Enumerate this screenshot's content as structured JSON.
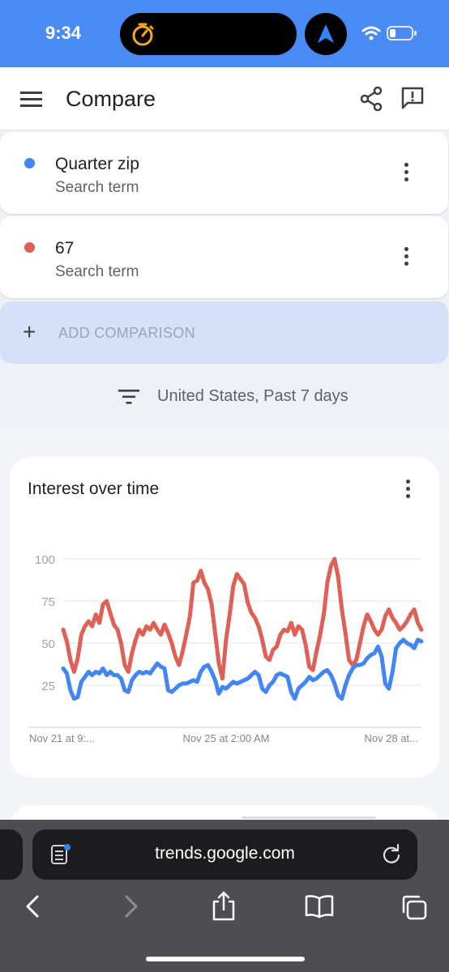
{
  "status_bar": {
    "time": "9:34"
  },
  "app_bar": {
    "title": "Compare"
  },
  "terms": [
    {
      "name": "Quarter zip",
      "subtitle": "Search term",
      "color": "#4285f4"
    },
    {
      "name": "67",
      "subtitle": "Search term",
      "color": "#e06055"
    }
  ],
  "add_comparison": {
    "label": "ADD COMPARISON"
  },
  "filter": {
    "text": "United States, Past 7 days"
  },
  "chart_card": {
    "title": "Interest over time"
  },
  "chart_data": {
    "type": "line",
    "ylim": [
      0,
      100
    ],
    "yticks": [
      "100",
      "75",
      "50",
      "25"
    ],
    "xticks": [
      "Nov 21 at 9:...",
      "Nov 25 at 2:00 AM",
      "Nov 28 at..."
    ],
    "series": [
      {
        "name": "Quarter zip",
        "color": "#4285f4",
        "values": [
          35,
          32,
          22,
          17,
          18,
          27,
          30,
          33,
          31,
          33,
          32,
          35,
          31,
          33,
          31,
          31,
          29,
          22,
          21,
          28,
          31,
          33,
          32,
          33,
          32,
          35,
          38,
          36,
          35,
          22,
          21,
          23,
          25,
          26,
          26,
          27,
          28,
          27,
          33,
          36,
          37,
          33,
          28,
          20,
          24,
          23,
          25,
          27,
          26,
          27,
          28,
          29,
          31,
          33,
          31,
          23,
          21,
          25,
          27,
          31,
          32,
          31,
          30,
          21,
          17,
          23,
          25,
          27,
          30,
          28,
          29,
          31,
          33,
          34,
          31,
          26,
          19,
          17,
          25,
          31,
          35,
          37,
          37,
          38,
          41,
          43,
          44,
          48,
          42,
          26,
          23,
          33,
          47,
          50,
          52,
          50,
          49,
          47,
          52,
          51
        ]
      },
      {
        "name": "67",
        "color": "#e06055",
        "values": [
          58,
          51,
          40,
          33,
          41,
          55,
          60,
          63,
          60,
          67,
          62,
          73,
          75,
          68,
          61,
          58,
          50,
          37,
          33,
          44,
          52,
          58,
          55,
          60,
          58,
          62,
          58,
          55,
          61,
          56,
          50,
          42,
          37,
          45,
          55,
          66,
          86,
          87,
          93,
          86,
          82,
          73,
          56,
          38,
          29,
          52,
          67,
          84,
          91,
          88,
          85,
          74,
          68,
          65,
          60,
          52,
          42,
          40,
          46,
          48,
          55,
          58,
          57,
          62,
          55,
          60,
          58,
          49,
          36,
          34,
          45,
          55,
          67,
          86,
          96,
          100,
          89,
          70,
          56,
          40,
          37,
          40,
          50,
          60,
          67,
          63,
          58,
          55,
          58,
          66,
          70,
          65,
          62,
          58,
          60,
          63,
          67,
          70,
          62,
          58
        ]
      }
    ]
  },
  "browser": {
    "url": "trends.google.com"
  },
  "icons": {
    "status": [
      "timer-icon",
      "navigation-arrow-icon",
      "wifi-icon",
      "battery-icon"
    ],
    "app_bar": [
      "menu-icon",
      "share-icon",
      "feedback-icon"
    ],
    "toolbar": [
      "back-icon",
      "forward-icon",
      "share-icon",
      "bookmarks-icon",
      "tabs-icon"
    ]
  }
}
